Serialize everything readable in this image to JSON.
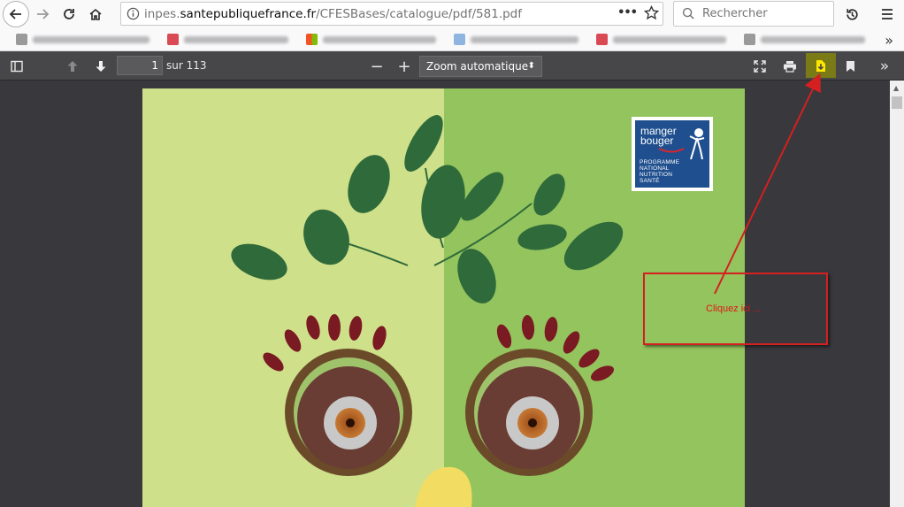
{
  "browser": {
    "url_prefix": "inpes.",
    "url_domain": "santepubliquefrance.fr",
    "url_path": "/CFESBases/catalogue/pdf/581.pdf",
    "page_actions_icon": "•••",
    "search_placeholder": "Rechercher",
    "bookmarks_more": "»"
  },
  "pdf_toolbar": {
    "page_number": "1",
    "page_count": "sur 113",
    "zoom_out": "−",
    "zoom_in": "+",
    "zoom_value": "Zoom automatique",
    "zoom_caret": "⬍",
    "more_tools": "»"
  },
  "document": {
    "logo_line1": "manger",
    "logo_line2": "bouger",
    "logo_program": [
      "PROGRAMME",
      "NATIONAL",
      "NUTRITION",
      "SANTÉ"
    ]
  },
  "annotation": {
    "text": "Cliquez ici ...",
    "color": "#e01818"
  },
  "colors": {
    "download_highlight": "#7a7a17",
    "toolbar": "#474749",
    "viewer_bg": "#38383d"
  }
}
